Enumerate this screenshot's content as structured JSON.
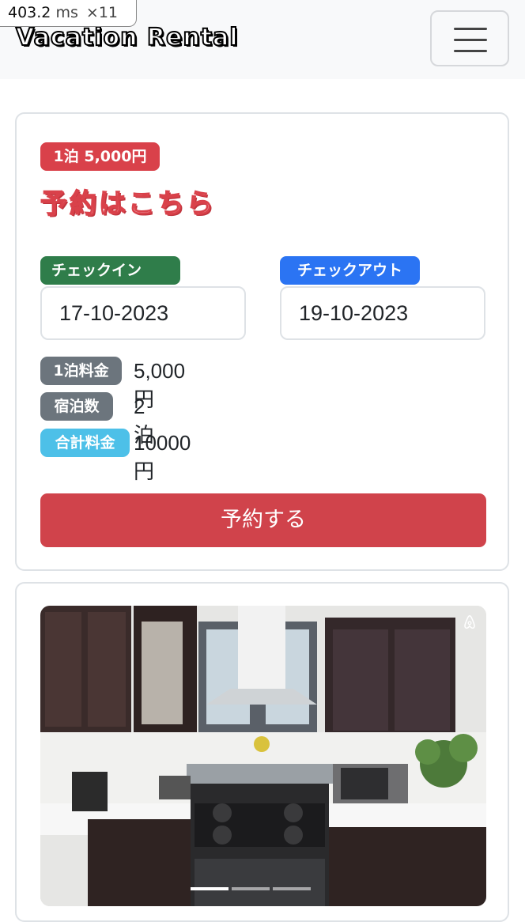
{
  "perf": {
    "ms_value": "403.2",
    "ms_unit": "ms",
    "multiplier": "×11"
  },
  "navbar": {
    "brand": "Vacation Rental"
  },
  "reservation": {
    "price_badge": "1泊 5,000円",
    "title": "予約はこちら",
    "checkin_label": "チェックイン",
    "checkout_label": "チェックアウト",
    "checkin_value": "17-10-2023",
    "checkout_value": "19-10-2023",
    "rows": [
      {
        "label": "1泊料金",
        "value": "5,000円",
        "color": "#6c757d"
      },
      {
        "label": "宿泊数",
        "value": "2泊",
        "color": "#6c757d"
      },
      {
        "label": "合計料金",
        "value": "10000円",
        "color": "#4dc0e8"
      }
    ],
    "submit": "予約する"
  },
  "gallery": {
    "image": "kitchen-photo",
    "icon": "airbnb-icon",
    "slides": 3,
    "active_slide": 1
  },
  "colors": {
    "danger": "#d9414a",
    "success": "#2f7d4a",
    "primary": "#2b74f3",
    "secondary": "#6c757d",
    "info": "#4dc0e8"
  }
}
